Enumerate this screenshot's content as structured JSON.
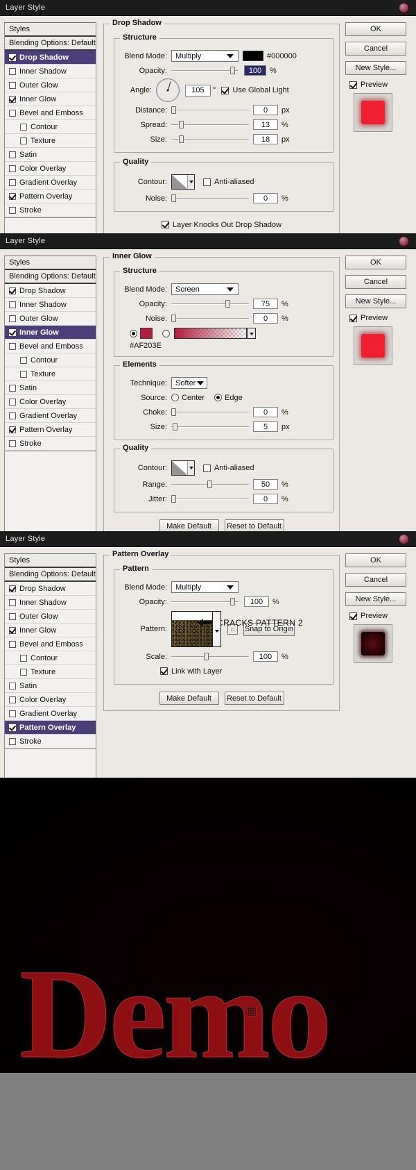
{
  "app": {
    "window_title": "Layer Style"
  },
  "styles_list": {
    "header_styles": "Styles",
    "header_blending": "Blending Options: Default",
    "items": [
      {
        "label": "Drop Shadow",
        "checked": true,
        "indent": false
      },
      {
        "label": "Inner Shadow",
        "checked": false,
        "indent": false
      },
      {
        "label": "Outer Glow",
        "checked": false,
        "indent": false
      },
      {
        "label": "Inner Glow",
        "checked": true,
        "indent": false
      },
      {
        "label": "Bevel and Emboss",
        "checked": false,
        "indent": false
      },
      {
        "label": "Contour",
        "checked": false,
        "indent": true
      },
      {
        "label": "Texture",
        "checked": false,
        "indent": true
      },
      {
        "label": "Satin",
        "checked": false,
        "indent": false
      },
      {
        "label": "Color Overlay",
        "checked": false,
        "indent": false
      },
      {
        "label": "Gradient Overlay",
        "checked": false,
        "indent": false
      },
      {
        "label": "Pattern Overlay",
        "checked": true,
        "indent": false
      },
      {
        "label": "Stroke",
        "checked": false,
        "indent": false
      }
    ]
  },
  "buttons": {
    "ok": "OK",
    "cancel": "Cancel",
    "new_style": "New Style...",
    "preview": "Preview",
    "make_default": "Make Default",
    "reset_to_default": "Reset to Default",
    "snap_to_origin": "Snap to Origin"
  },
  "dialog1": {
    "selected_style": "Drop Shadow",
    "group_title": "Drop Shadow",
    "structure_title": "Structure",
    "quality_title": "Quality",
    "blend_mode_label": "Blend Mode:",
    "blend_mode_value": "Multiply",
    "color_hex": "#000000",
    "opacity_label": "Opacity:",
    "opacity_value": "100",
    "opacity_unit": "%",
    "angle_label": "Angle:",
    "angle_value": "105",
    "angle_unit": "°",
    "use_global_light": "Use Global Light",
    "use_global_light_checked": true,
    "distance_label": "Distance:",
    "distance_value": "0",
    "distance_unit": "px",
    "spread_label": "Spread:",
    "spread_value": "13",
    "spread_unit": "%",
    "size_label": "Size:",
    "size_value": "18",
    "size_unit": "px",
    "contour_label": "Contour:",
    "anti_aliased": "Anti-aliased",
    "anti_aliased_checked": false,
    "noise_label": "Noise:",
    "noise_value": "0",
    "noise_unit": "%",
    "knockout_label": "Layer Knocks Out Drop Shadow",
    "knockout_checked": true,
    "preview_color": "#f02030"
  },
  "dialog2": {
    "selected_style": "Inner Glow",
    "group_title": "Inner Glow",
    "structure_title": "Structure",
    "elements_title": "Elements",
    "quality_title": "Quality",
    "blend_mode_label": "Blend Mode:",
    "blend_mode_value": "Screen",
    "opacity_label": "Opacity:",
    "opacity_value": "75",
    "opacity_unit": "%",
    "noise_label": "Noise:",
    "noise_value": "0",
    "noise_unit": "%",
    "glow_color": "#AF203E",
    "glow_hex_label": "#AF203E",
    "color_radio_selected": true,
    "technique_label": "Technique:",
    "technique_value": "Softer",
    "source_label": "Source:",
    "source_center": "Center",
    "source_edge": "Edge",
    "source_selected": "Edge",
    "choke_label": "Choke:",
    "choke_value": "0",
    "choke_unit": "%",
    "size_label": "Size:",
    "size_value": "5",
    "size_unit": "px",
    "contour_label": "Contour:",
    "anti_aliased": "Anti-aliased",
    "anti_aliased_checked": false,
    "range_label": "Range:",
    "range_value": "50",
    "range_unit": "%",
    "jitter_label": "Jitter:",
    "jitter_value": "0",
    "jitter_unit": "%",
    "preview_color": "#f02030"
  },
  "dialog3": {
    "selected_style": "Pattern Overlay",
    "group_title": "Pattern Overlay",
    "pattern_title": "Pattern",
    "blend_mode_label": "Blend Mode:",
    "blend_mode_value": "Multiply",
    "opacity_label": "Opacity:",
    "opacity_value": "100",
    "opacity_unit": "%",
    "pattern_label": "Pattern:",
    "pattern_annotation": "CRACKS PATTERN 2",
    "scale_label": "Scale:",
    "scale_value": "100",
    "scale_unit": "%",
    "link_with_layer": "Link with Layer",
    "link_with_layer_checked": true,
    "preview_color": "#2b0608"
  },
  "artwork": {
    "text": "Demo"
  }
}
